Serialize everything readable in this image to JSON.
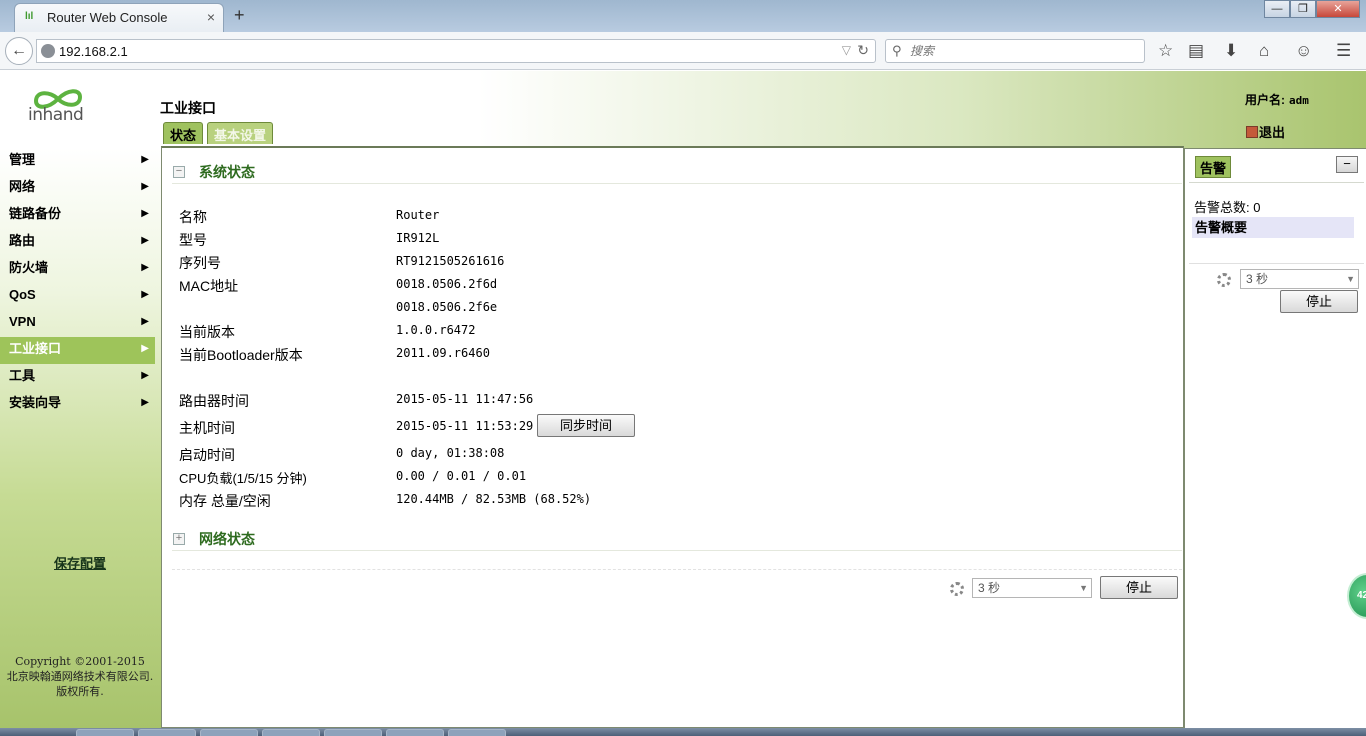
{
  "browser": {
    "tab_title": "Router Web Console",
    "tab_close": "×",
    "new_tab": "+",
    "url": "192.168.2.1",
    "search_placeholder": "搜索",
    "window_controls": {
      "minimize": "—",
      "maximize": "❐",
      "close": "✕"
    }
  },
  "header": {
    "logo_text": "inhand",
    "page_title": "工业接口",
    "tabs": [
      {
        "label": "状态"
      },
      {
        "label": "基本设置"
      }
    ],
    "user_label": "用户名:",
    "user_value": "adm",
    "logout": "退出"
  },
  "sidebar": {
    "items": [
      {
        "label": "管理",
        "arrow": "▶"
      },
      {
        "label": "网络",
        "arrow": "▶"
      },
      {
        "label": "链路备份",
        "arrow": "▶"
      },
      {
        "label": "路由",
        "arrow": "▶"
      },
      {
        "label": "防火墙",
        "arrow": "▶"
      },
      {
        "label": "QoS",
        "arrow": "▶"
      },
      {
        "label": "VPN",
        "arrow": "▶"
      },
      {
        "label": "工业接口",
        "arrow": "▶"
      },
      {
        "label": "工具",
        "arrow": "▶"
      },
      {
        "label": "安装向导",
        "arrow": "▶"
      }
    ],
    "active_index": 7,
    "save_config": "保存配置",
    "copyright_line1": "Copyright ©2001-2015",
    "copyright_line2": "北京映翰通网络技术有限公司.",
    "copyright_line3": "版权所有."
  },
  "main": {
    "system_status": {
      "toggle": "−",
      "title": "系统状态",
      "rows": {
        "name": {
          "label": "名称",
          "value": "Router"
        },
        "model": {
          "label": "型号",
          "value": "IR912L"
        },
        "serial": {
          "label": "序列号",
          "value": "RT9121505261616"
        },
        "mac": {
          "label": "MAC地址",
          "value1": "0018.0506.2f6d",
          "value2": "0018.0506.2f6e"
        },
        "version": {
          "label": "当前版本",
          "value": "1.0.0.r6472"
        },
        "bootloader": {
          "label": "当前Bootloader版本",
          "value": "2011.09.r6460"
        },
        "router_time": {
          "label": "路由器时间",
          "value": "2015-05-11 11:47:56"
        },
        "host_time": {
          "label": "主机时间",
          "value": "2015-05-11 11:53:29",
          "sync_button": "同步时间"
        },
        "uptime": {
          "label": "启动时间",
          "value": "0 day, 01:38:08"
        },
        "cpu": {
          "label": "CPU负载(1/5/15 分钟)",
          "value": "0.00 / 0.01 / 0.01"
        },
        "memory": {
          "label": "内存 总量/空闲",
          "value": "120.44MB / 82.53MB (68.52%)"
        }
      }
    },
    "network_status": {
      "toggle": "+",
      "title": "网络状态"
    },
    "refresh_interval": "3 秒",
    "stop_button": "停止"
  },
  "alarm_panel": {
    "tab": "告警",
    "minimize": "−",
    "total": "告警总数: 0",
    "summary": "告警概要",
    "refresh_interval": "3 秒",
    "stop_button": "停止"
  },
  "floating_badge": "42",
  "colors": {
    "accent_green": "#9ec45a",
    "section_title": "#2e6b1f",
    "header_gradient_end": "#a9c46e"
  }
}
